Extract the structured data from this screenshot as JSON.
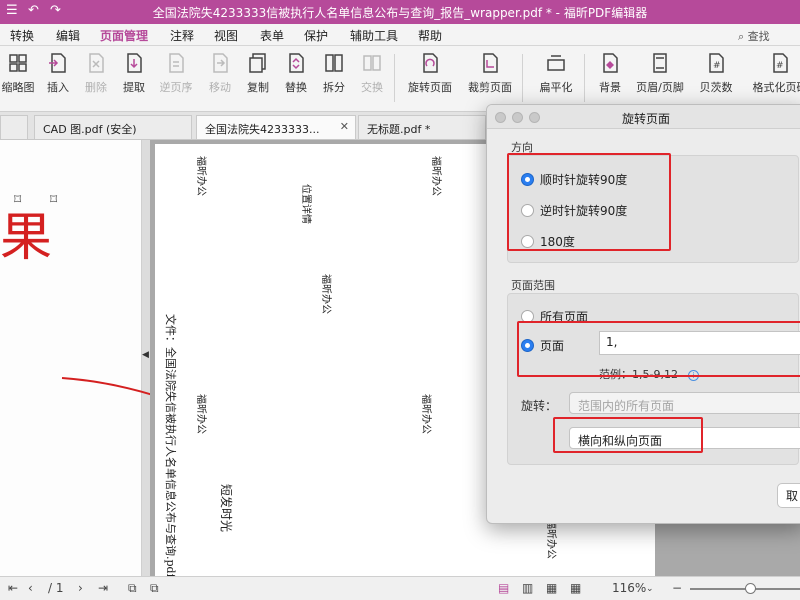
{
  "window": {
    "title": "全国法院失4233333信被执行人名单信息公布与查询_报告_wrapper.pdf * - 福昕PDF编辑器"
  },
  "menu": {
    "items": [
      "转换",
      "编辑",
      "页面管理",
      "注释",
      "视图",
      "表单",
      "保护",
      "辅助工具",
      "帮助"
    ],
    "active": "页面管理",
    "search_placeholder": "查找"
  },
  "toolbar": {
    "tools": [
      {
        "label": "缩略图",
        "icon": "thumbnails-icon",
        "enabled": true
      },
      {
        "label": "插入",
        "icon": "insert-page-icon",
        "enabled": true
      },
      {
        "label": "删除",
        "icon": "delete-page-icon",
        "enabled": false
      },
      {
        "label": "提取",
        "icon": "extract-page-icon",
        "enabled": true
      },
      {
        "label": "逆页序",
        "icon": "reverse-order-icon",
        "enabled": false
      },
      {
        "label": "移动",
        "icon": "move-page-icon",
        "enabled": false
      },
      {
        "label": "复制",
        "icon": "copy-page-icon",
        "enabled": true
      },
      {
        "label": "替换",
        "icon": "replace-page-icon",
        "enabled": true
      },
      {
        "label": "拆分",
        "icon": "split-icon",
        "enabled": true
      },
      {
        "label": "交换",
        "icon": "swap-icon",
        "enabled": false
      },
      {
        "label": "旋转页面",
        "icon": "rotate-page-icon",
        "enabled": true
      },
      {
        "label": "裁剪页面",
        "icon": "crop-page-icon",
        "enabled": true
      },
      {
        "label": "扁平化",
        "icon": "flatten-icon",
        "enabled": true
      },
      {
        "label": "背景",
        "icon": "background-icon",
        "enabled": true
      },
      {
        "label": "页眉/页脚",
        "icon": "header-footer-icon",
        "enabled": true
      },
      {
        "label": "贝茨数",
        "icon": "bates-number-icon",
        "enabled": true
      },
      {
        "label": "格式化页码",
        "icon": "format-page-number-icon",
        "enabled": true
      }
    ]
  },
  "tabs": [
    {
      "label": "CAD 图.pdf (安全)",
      "active": false
    },
    {
      "label": "全国法院失4233333...",
      "active": true
    },
    {
      "label": "无标题.pdf *",
      "active": false
    }
  ],
  "annotation": {
    "big_char": "果"
  },
  "document": {
    "lines": [
      "福昕办公",
      "位置详情",
      "福昕办公",
      "福昕办公",
      "福昕办公",
      "短发时光",
      "福昕办公",
      "福昕办公",
      "文件：全国法院失信被执行人名单信息公布与查询.pdf"
    ]
  },
  "dialog": {
    "title": "旋转页面",
    "direction": {
      "label": "方向",
      "options": [
        "顺时针旋转90度",
        "逆时针旋转90度",
        "180度"
      ],
      "selected": 0
    },
    "range": {
      "label": "页面范围",
      "all_pages": "所有页面",
      "pages": "页面",
      "pages_value": "1,",
      "example": "范例：1,5-9,12",
      "selected": "pages"
    },
    "rotate": {
      "label": "旋转：",
      "scope_value": "范围内的所有页面",
      "orientation_value": "横向和纵向页面"
    },
    "cancel_label": "取"
  },
  "status": {
    "page_sep": "/ 1",
    "zoom": "116%"
  },
  "colors": {
    "brand": "#b64a9a",
    "highlight": "#e0242a",
    "accent": "#2a7ef0"
  }
}
